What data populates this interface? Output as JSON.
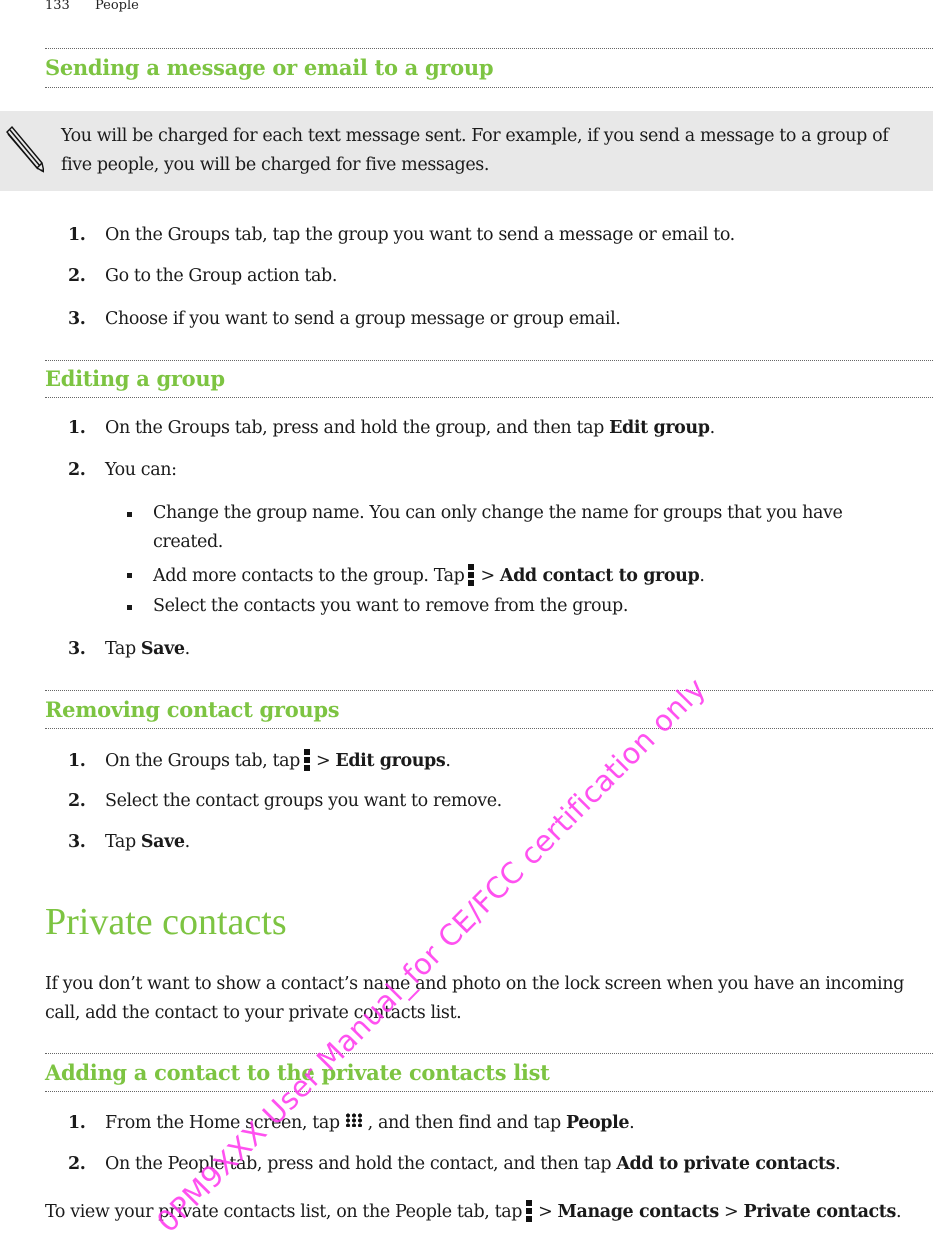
{
  "header": {
    "page_number": "133",
    "chapter": "People"
  },
  "sections": {
    "send_group": {
      "title": "Sending a message or email to a group",
      "note": {
        "icon": "pencil-icon",
        "line1": "You will be charged for each text message sent. For example, if you send a message to a group of",
        "line2": "five people, you will be charged for five messages."
      },
      "steps": [
        {
          "num": "1.",
          "text": "On the Groups tab, tap the group you want to send a message or email to."
        },
        {
          "num": "2.",
          "text": "Go to the Group action tab."
        },
        {
          "num": "3.",
          "text": "Choose if you want to send a group message or group email."
        }
      ]
    },
    "edit_group": {
      "title": "Editing a group",
      "step1": {
        "num": "1.",
        "pre": "On the Groups tab, press and hold the group, and then tap ",
        "bold": "Edit group",
        "post": "."
      },
      "step2": {
        "num": "2.",
        "text": "You can:"
      },
      "bullets": {
        "b1_line1": "Change the group name. You can only change the name for groups that you have",
        "b1_line2": "created.",
        "b2_pre": "Add more contacts to the group. Tap",
        "b2_sep": "> ",
        "b2_bold": "Add contact to group",
        "b2_post": ".",
        "b3": "Select the contacts you want to remove from the group."
      },
      "step3": {
        "num": "3.",
        "pre": "Tap ",
        "bold": "Save",
        "post": "."
      }
    },
    "remove_groups": {
      "title": "Removing contact groups",
      "step1": {
        "num": "1.",
        "pre": "On the Groups tab, tap",
        "sep": "> ",
        "bold": "Edit groups",
        "post": "."
      },
      "step2": {
        "num": "2.",
        "text": "Select the contact groups you want to remove."
      },
      "step3": {
        "num": "3.",
        "pre": "Tap ",
        "bold": "Save",
        "post": "."
      }
    },
    "private_contacts": {
      "title": "Private contacts",
      "intro_line1": "If you don’t want to show a contact’s name and photo on the lock screen when you have an incoming",
      "intro_line2": "call, add the contact to your private contacts list."
    },
    "add_private": {
      "title": "Adding a contact to the private contacts list",
      "step1": {
        "num": "1.",
        "pre": "From the Home screen, tap",
        "mid": ", and then find and tap ",
        "bold": "People",
        "post": "."
      },
      "step2": {
        "num": "2.",
        "pre": "On the People tab, press and hold the contact, and then tap ",
        "bold": "Add to private contacts",
        "post": "."
      },
      "footer": {
        "pre": "To view your private contacts list, on the People tab, tap",
        "sep1": "> ",
        "bold1": "Manage contacts",
        "sep2": " > ",
        "bold2": "Private contacts",
        "post": "."
      }
    }
  },
  "icons": {
    "menu": "more-vert-icon",
    "apps": "all-apps-icon"
  },
  "watermark": "0PM9XXX User Manual_for CE/FCC certification only",
  "colors": {
    "heading": "#7dc442",
    "note_bg": "#e8e8e8",
    "watermark": "#ff33ee"
  }
}
